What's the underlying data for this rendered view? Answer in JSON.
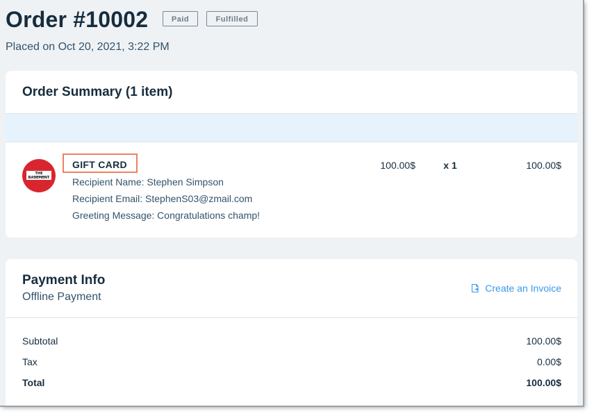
{
  "header": {
    "title": "Order #10002",
    "badges": {
      "paid": "Paid",
      "fulfilled": "Fulfilled"
    },
    "placed": "Placed on Oct 20, 2021, 3:22 PM"
  },
  "summary": {
    "title": "Order Summary (1 item)",
    "item": {
      "thumbnail_text": "THE BASEMENT",
      "name": "GIFT CARD",
      "recipient_name": "Recipient Name: Stephen Simpson",
      "recipient_email": "Recipient Email: StephenS03@zmail.com",
      "greeting": "Greeting Message: Congratulations champ!",
      "price": "100.00$",
      "quantity": "x 1",
      "total": "100.00$"
    }
  },
  "payment": {
    "title": "Payment Info",
    "method": "Offline Payment",
    "invoice_link": "Create an Invoice",
    "rows": [
      {
        "label": "Subtotal",
        "value": "100.00$"
      },
      {
        "label": "Tax",
        "value": "0.00$"
      },
      {
        "label": "Total",
        "value": "100.00$"
      }
    ]
  },
  "colors": {
    "text_primary": "#162d3d",
    "text_secondary": "#32536a",
    "link": "#3899ec",
    "highlight_border": "#f0805f",
    "band": "#e7f3fc",
    "page_bg": "#eff2f5",
    "thumbnail_bg": "#d9262e"
  },
  "icons": {
    "invoice": "invoice-document-icon"
  }
}
